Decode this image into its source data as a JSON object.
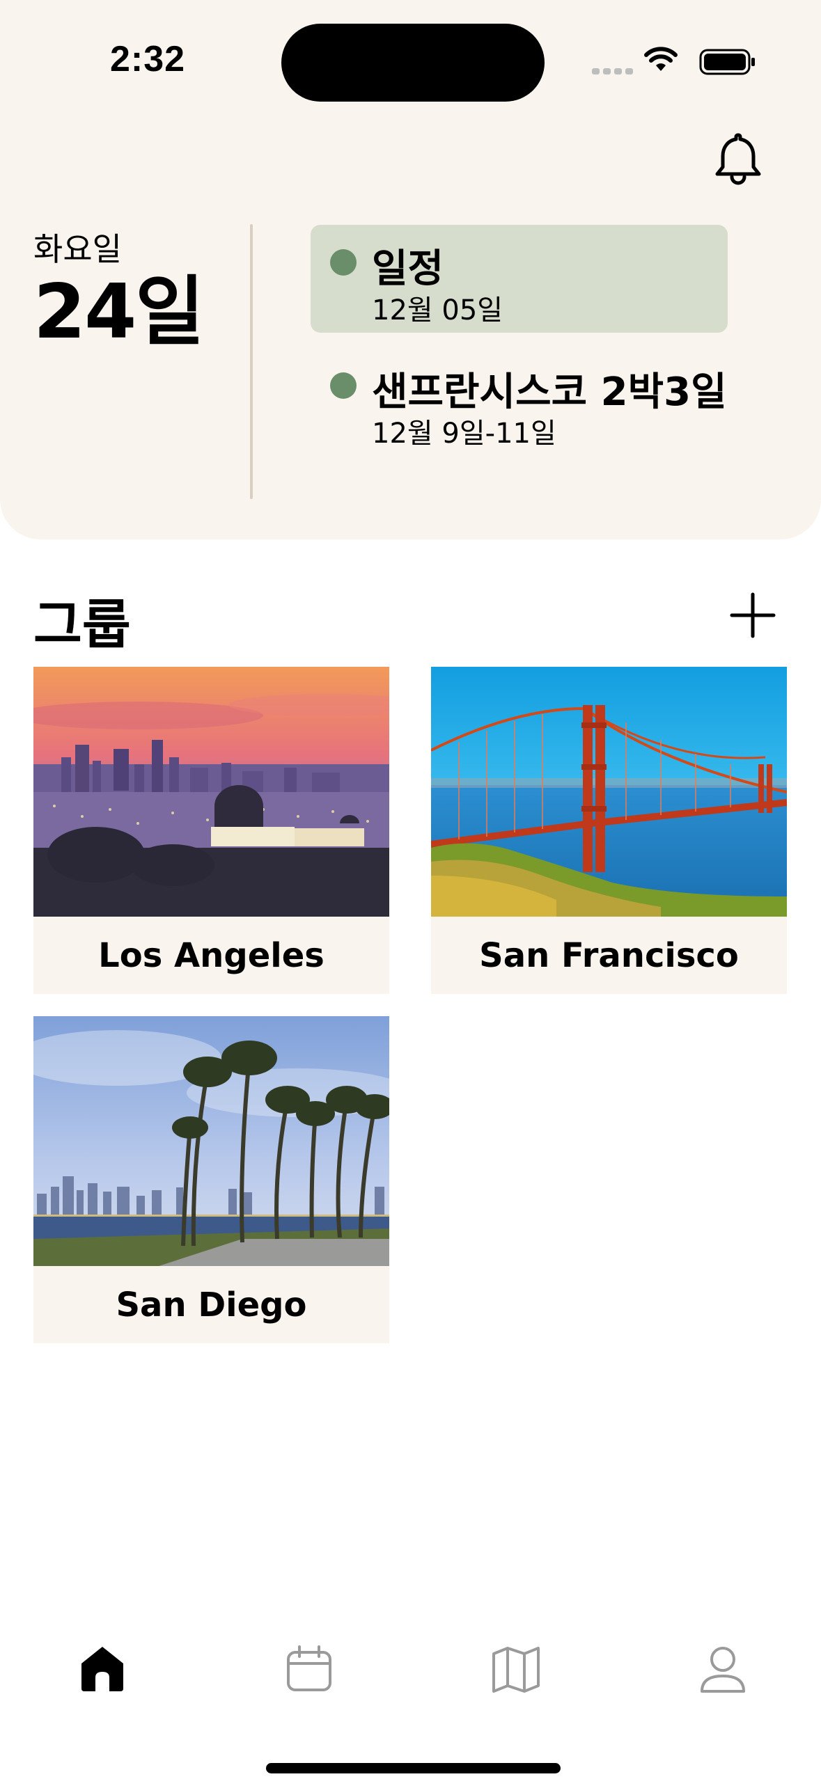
{
  "status_bar": {
    "time": "2:32",
    "icons": [
      "signal-icon",
      "wifi-icon",
      "battery-icon"
    ]
  },
  "header": {
    "notification_icon": "bell-icon",
    "weekday": "화요일",
    "day": "24일",
    "events": [
      {
        "title": "일정",
        "date": "12월 05일",
        "highlighted": true,
        "dot_color": "#6b8e6a"
      },
      {
        "title": "샌프란시스코 2박3일",
        "date": "12월 9일-11일",
        "highlighted": false,
        "dot_color": "#6b8e6a"
      }
    ]
  },
  "groups": {
    "title": "그룹",
    "add_icon": "plus-icon",
    "items": [
      {
        "name": "Los Angeles"
      },
      {
        "name": "San Francisco"
      },
      {
        "name": "San Diego"
      }
    ]
  },
  "tab_bar": {
    "tabs": [
      {
        "icon": "home-icon",
        "selected": true
      },
      {
        "icon": "calendar-icon",
        "selected": false
      },
      {
        "icon": "map-icon",
        "selected": false
      },
      {
        "icon": "profile-icon",
        "selected": false
      }
    ]
  },
  "colors": {
    "header_background": "#f9f5ee",
    "highlight_background": "#d6ddcc",
    "accent_dot": "#6b8e6a",
    "inactive_icon": "#9a9a9a"
  }
}
